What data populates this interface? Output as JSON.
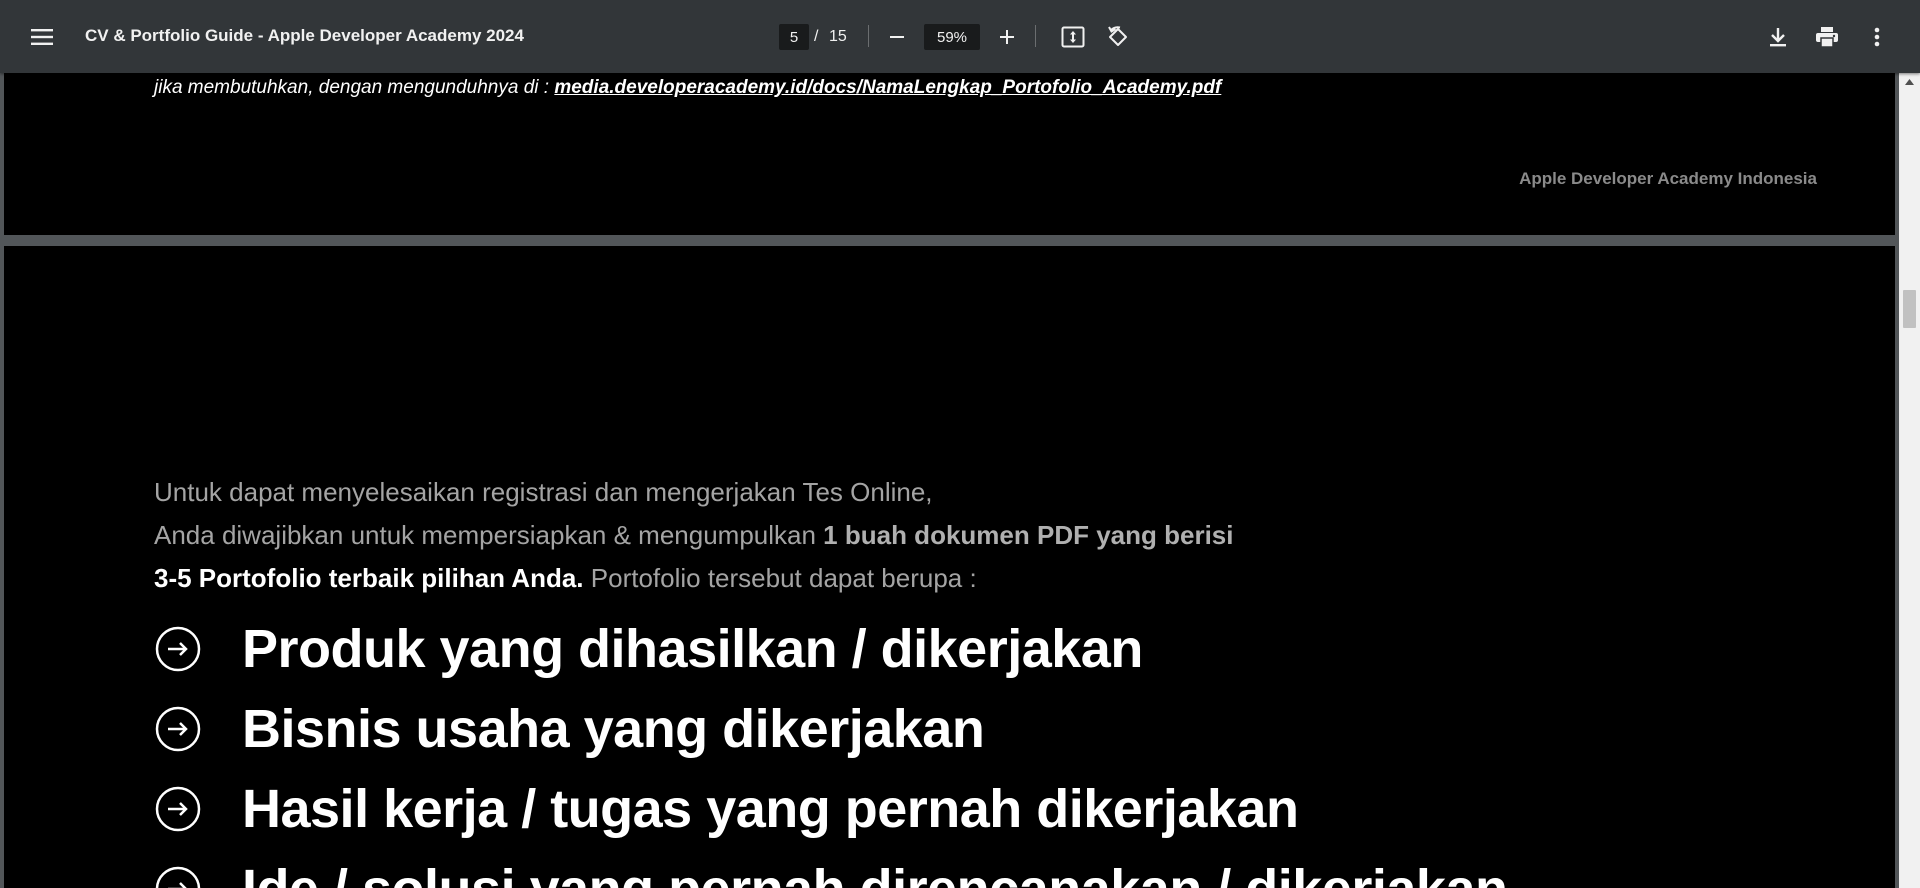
{
  "toolbar": {
    "title": "CV & Portfolio Guide - Apple Developer Academy 2024",
    "current_page": "5",
    "page_separator": "/",
    "total_pages": "15",
    "zoom": "59%",
    "icons": {
      "menu": "menu-icon",
      "zoom_out": "minus-icon",
      "zoom_in": "plus-icon",
      "fit": "fit-to-page-icon",
      "rotate": "rotate-counterclockwise-icon",
      "download": "download-icon",
      "print": "print-icon",
      "more": "more-vertical-icon"
    }
  },
  "prev_page": {
    "link_prefix": "jika membutuhkan, dengan mengunduhnya di :",
    "link_text": "media.developeracademy.id/docs/NamaLengkap_Portofolio_Academy.pdf",
    "footer": "Apple Developer Academy Indonesia"
  },
  "current_page": {
    "intro_line1": "Untuk dapat menyelesaikan registrasi dan mengerjakan Tes Online,",
    "intro_line2_a": "Anda diwajibkan untuk mempersiapkan & mengumpulkan",
    "intro_line2_b": "1 buah dokumen PDF yang berisi",
    "intro_line3_a": "3-5 Portofolio terbaik pilihan Anda.",
    "intro_line3_b": "Portofolio tersebut dapat berupa :",
    "items": [
      "Produk yang dihasilkan / dikerjakan",
      "Bisnis usaha yang dikerjakan",
      "Hasil kerja / tugas yang pernah dikerjakan",
      "Ide / solusi yang pernah direncanakan / dikerjakan"
    ],
    "item_icon": "arrow-right-circle-icon"
  },
  "colors": {
    "toolbar_bg": "#323639",
    "viewer_bg": "#525659",
    "page_bg": "#000000"
  }
}
